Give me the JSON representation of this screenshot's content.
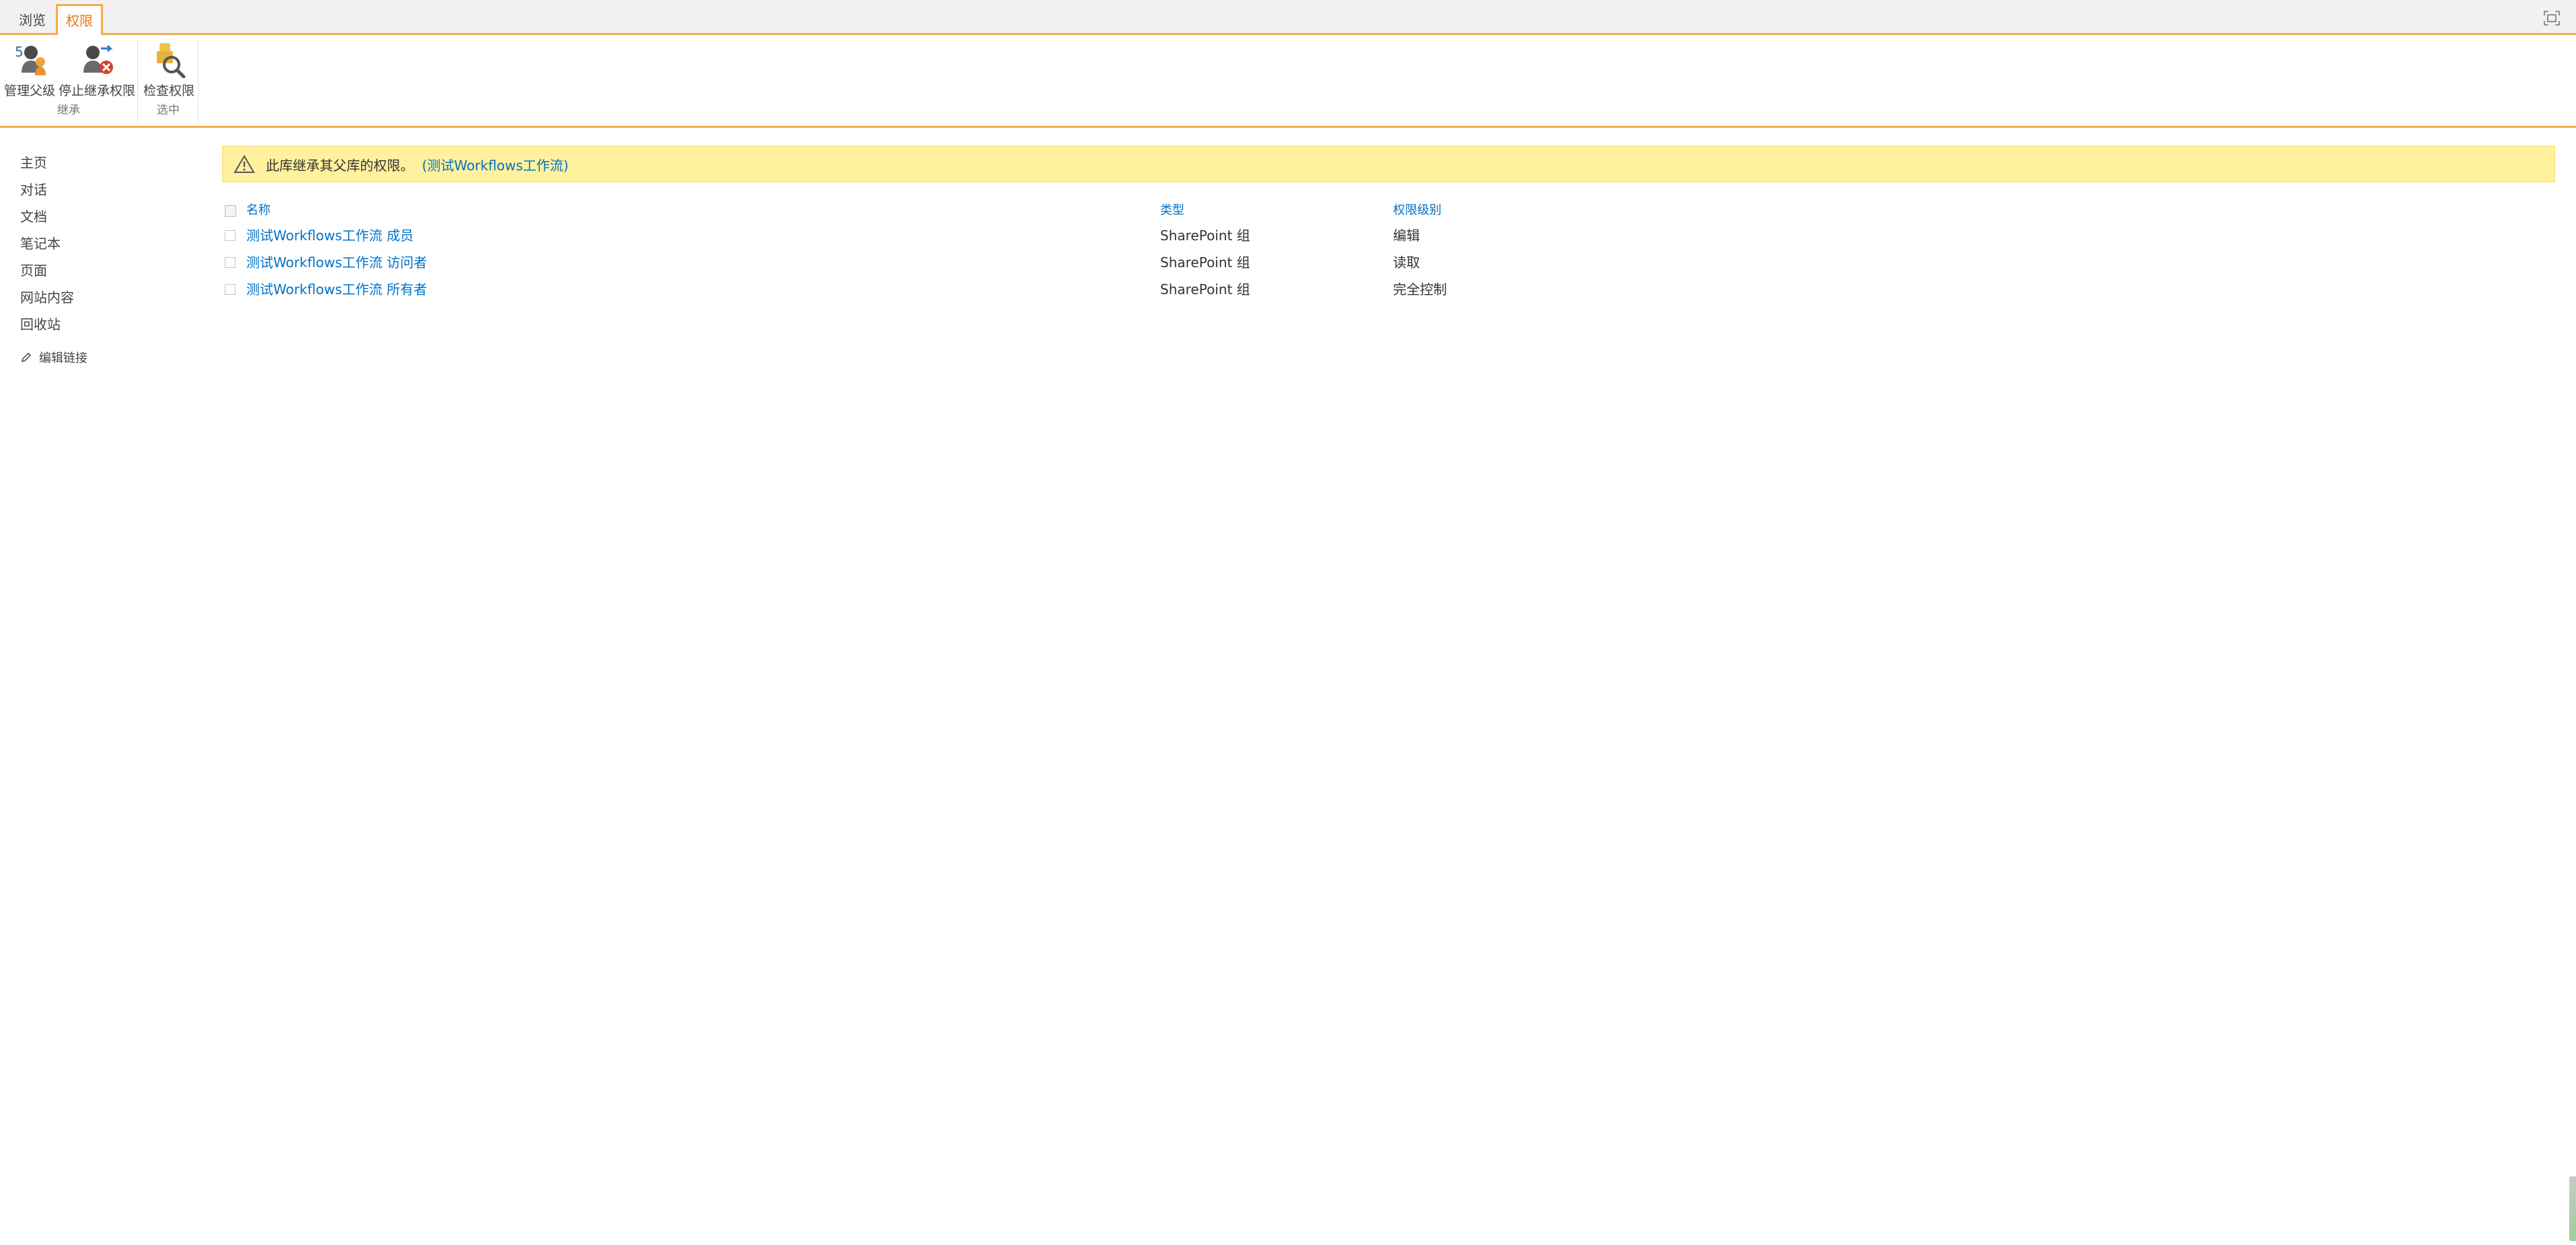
{
  "ribbon": {
    "tabs": [
      {
        "label": "浏览"
      },
      {
        "label": "权限"
      }
    ],
    "buttons": {
      "manage_parent": "管理父级",
      "stop_inheriting": "停止继承权限",
      "check_permissions": "检查权限"
    },
    "groups": {
      "inheritance": "继承",
      "check": "选中"
    }
  },
  "nav": {
    "items": [
      {
        "label": "主页"
      },
      {
        "label": "对话"
      },
      {
        "label": "文档"
      },
      {
        "label": "笔记本"
      },
      {
        "label": "页面"
      },
      {
        "label": "网站内容"
      },
      {
        "label": "回收站"
      }
    ],
    "edit_links": "编辑链接"
  },
  "notice": {
    "message": "此库继承其父库的权限。",
    "link": "(测试Workflows工作流)"
  },
  "grid": {
    "headers": {
      "name": "名称",
      "type": "类型",
      "level": "权限级别"
    },
    "rows": [
      {
        "name": "测试Workflows工作流 成员",
        "type": "SharePoint 组",
        "level": "编辑"
      },
      {
        "name": "测试Workflows工作流 访问者",
        "type": "SharePoint 组",
        "level": "读取"
      },
      {
        "name": "测试Workflows工作流 所有者",
        "type": "SharePoint 组",
        "level": "完全控制"
      }
    ]
  },
  "colors": {
    "accent_orange": "#f9a94b",
    "active_tab_text": "#e87811",
    "link_blue": "#0072c6",
    "notice_bg": "#fff19d"
  },
  "icons": {
    "manage_parent": "users-parent-icon",
    "stop_inheriting": "stop-inheritance-icon",
    "check_permissions": "check-permissions-icon",
    "focus": "focus-on-content-icon",
    "warning": "warning-icon",
    "edit": "pencil-icon"
  }
}
